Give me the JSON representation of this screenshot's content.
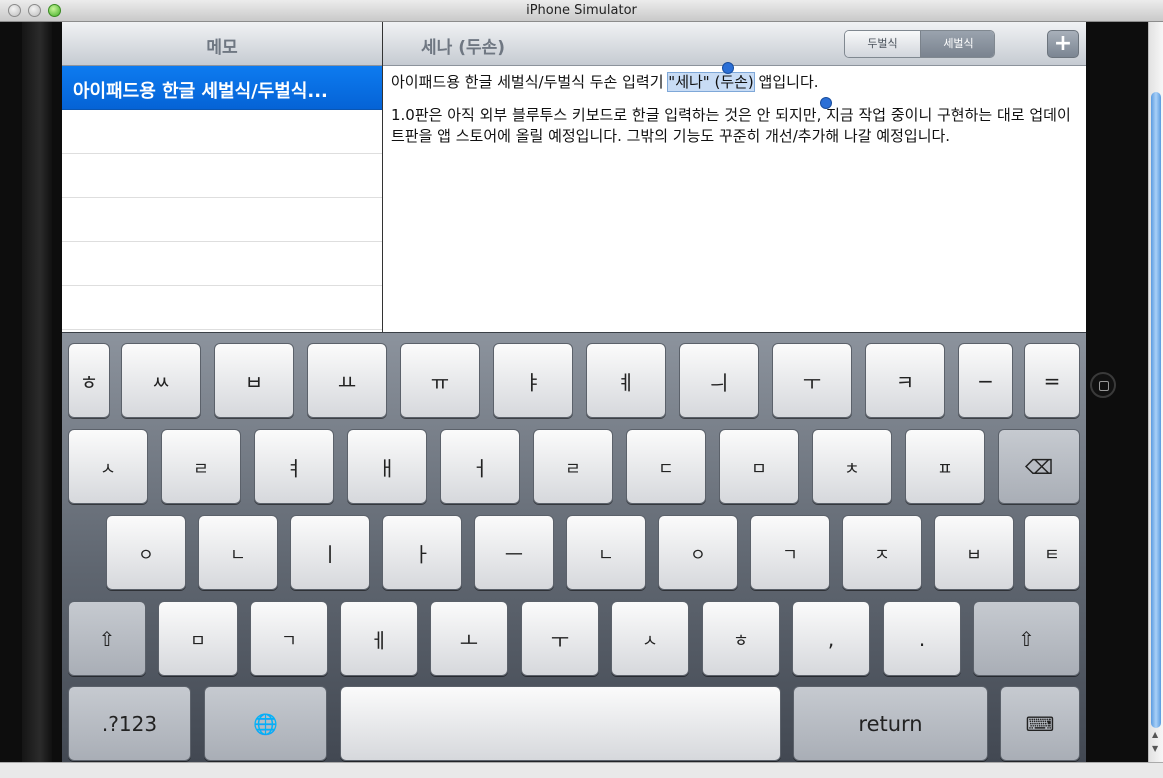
{
  "window": {
    "title": "iPhone Simulator"
  },
  "master": {
    "nav_title": "메모",
    "items": [
      {
        "label": "아이패드용 한글 세벌식/두벌식..."
      }
    ]
  },
  "detail": {
    "nav_title": "세나 (두손)",
    "segments": [
      "두벌식",
      "세벌식"
    ],
    "add_label": "+",
    "text": {
      "p1_before": "아이패드용 한글 세벌식/두벌식 두손 입력기 ",
      "p1_selected": "\"세나\" (두손)",
      "p1_after": " 앱입니다.",
      "p2": "1.0판은 아직 외부 블루투스 키보드로 한글 입력하는 것은 안 되지만, 지금 작업 중이니 구현하는 대로 업데이트판을 앱 스토어에 올릴 예정입니다. 그밖의 기능도 꾸준히 개선/추가해 나갈 예정입니다."
    }
  },
  "keyboard": {
    "row1": [
      "ㅎ",
      "ㅆ",
      "ㅂ",
      "ㅛ",
      "ㅠ",
      "ㅑ",
      "ㅖ",
      "ㅢ",
      "ㅜ",
      "ㅋ",
      "−",
      "="
    ],
    "row2": [
      "ㅅ",
      "ㄹ",
      "ㅕ",
      "ㅐ",
      "ㅓ",
      "ㄹ",
      "ㄷ",
      "ㅁ",
      "ㅊ",
      "ㅍ",
      "⌫"
    ],
    "row3": [
      "ㅇ",
      "ㄴ",
      "ㅣ",
      "ㅏ",
      "ㅡ",
      "ㄴ",
      "ㅇ",
      "ㄱ",
      "ㅈ",
      "ㅂ",
      "ㅌ"
    ],
    "row4": [
      "⇧",
      "ㅁ",
      "ㄱ",
      "ㅔ",
      "ㅗ",
      "ㅜ",
      "ㅅ",
      "ㅎ",
      ",",
      ".",
      "⇧"
    ],
    "row5": {
      "numbers": ".?123",
      "globe": "🌐",
      "space": "",
      "return": "return",
      "hide": "⌨"
    }
  }
}
